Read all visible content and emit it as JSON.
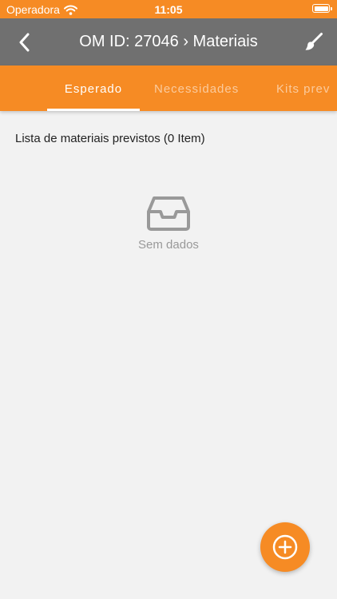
{
  "status_bar": {
    "carrier": "Operadora",
    "time": "11:05",
    "wifi_icon": "wifi-icon",
    "battery_icon": "battery-icon"
  },
  "nav": {
    "title": "OM ID: 27046 › Materiais",
    "back_icon": "chevron-left-icon",
    "action_icon": "paintbrush-icon"
  },
  "tabs": [
    {
      "label": "Esperado",
      "active": true
    },
    {
      "label": "Necessidades",
      "active": false
    },
    {
      "label": "Kits prev",
      "active": false
    }
  ],
  "list": {
    "title": "Lista de materiais previstos (0 Item)"
  },
  "empty_state": {
    "icon": "inbox-icon",
    "text": "Sem dados"
  },
  "fab": {
    "icon": "plus-circle-icon"
  },
  "colors": {
    "accent": "#f68b24",
    "nav_bar": "#707070",
    "background": "#f2f2f2",
    "muted_text": "#999999"
  }
}
